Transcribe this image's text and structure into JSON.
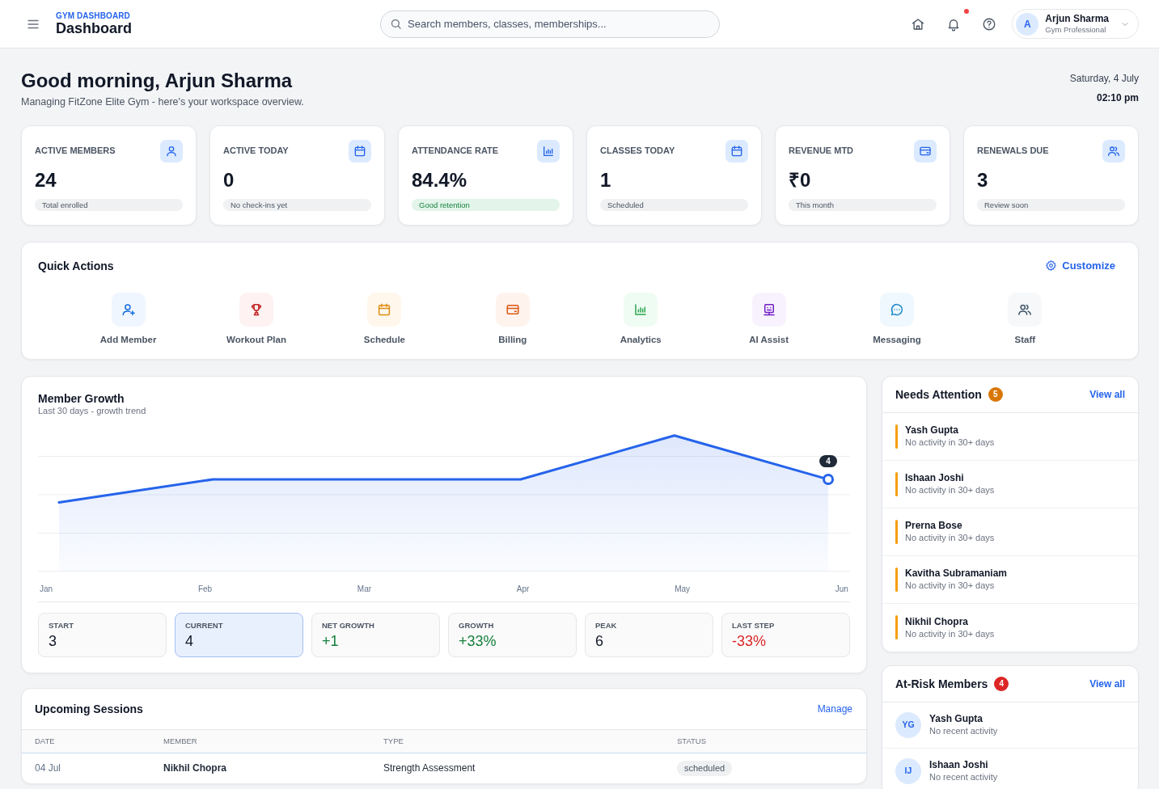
{
  "header": {
    "eyebrow": "GYM DASHBOARD",
    "title": "Dashboard",
    "search": {
      "placeholder": "Search members, classes, memberships..."
    },
    "unread_notifications": true,
    "user": {
      "initial": "A",
      "name": "Arjun Sharma",
      "role": "Gym Professional"
    }
  },
  "greeting": {
    "title": "Good morning, Arjun Sharma",
    "subtitle": "Managing FitZone Elite Gym - here's your workspace overview.",
    "date": "Saturday, 4 July",
    "time": "02:10 pm"
  },
  "stats": [
    {
      "label": "ACTIVE MEMBERS",
      "value": "24",
      "note": "Total enrolled",
      "kind": "neutral"
    },
    {
      "label": "ACTIVE TODAY",
      "value": "0",
      "note": "No check-ins yet",
      "kind": "neutral"
    },
    {
      "label": "ATTENDANCE RATE",
      "value": "84.4%",
      "note": "Good retention",
      "kind": "positive"
    },
    {
      "label": "CLASSES TODAY",
      "value": "1",
      "note": "Scheduled",
      "kind": "neutral"
    },
    {
      "label": "REVENUE MTD",
      "value": "₹0",
      "note": "This month",
      "kind": "neutral"
    },
    {
      "label": "RENEWALS DUE",
      "value": "3",
      "note": "Review soon",
      "kind": "neutral"
    }
  ],
  "quick_actions": {
    "title": "Quick Actions",
    "customize": "Customize",
    "items": [
      {
        "label": "Add Member",
        "color": "#eff6ff"
      },
      {
        "label": "Workout Plan",
        "color": "#fef2f2"
      },
      {
        "label": "Schedule",
        "color": "#fff7eb"
      },
      {
        "label": "Billing",
        "color": "#fff3ed"
      },
      {
        "label": "Analytics",
        "color": "#effcf3"
      },
      {
        "label": "AI Assist",
        "color": "#f8f2fe"
      },
      {
        "label": "Messaging",
        "color": "#eef8fe"
      },
      {
        "label": "Staff",
        "color": "#f6f8fa"
      }
    ]
  },
  "member_growth": {
    "title": "Member Growth",
    "subtitle": "Last 30 days - growth trend",
    "trend": {
      "x_labels": [
        "Jan",
        "Feb",
        "Mar",
        "Apr",
        "May",
        "Jun"
      ],
      "point_label": "4"
    },
    "stats": [
      {
        "label": "START",
        "value": "3",
        "kind": "neutral",
        "highlighted": false
      },
      {
        "label": "CURRENT",
        "value": "4",
        "kind": "neutral",
        "highlighted": true
      },
      {
        "label": "NET GROWTH",
        "value": "+1",
        "kind": "positive",
        "highlighted": false
      },
      {
        "label": "GROWTH",
        "value": "+33%",
        "kind": "positive",
        "highlighted": false
      },
      {
        "label": "PEAK",
        "value": "6",
        "kind": "neutral",
        "highlighted": false
      },
      {
        "label": "LAST STEP",
        "value": "-33%",
        "kind": "negative",
        "highlighted": false
      }
    ]
  },
  "upcoming_sessions": {
    "title": "Upcoming Sessions",
    "action": "Manage",
    "columns": [
      "DATE",
      "MEMBER",
      "TYPE",
      "STATUS"
    ],
    "rows": [
      {
        "date": "04 Jul",
        "member": "Nikhil Chopra",
        "type": "Strength Assessment",
        "status": "scheduled"
      }
    ]
  },
  "needs_attention": {
    "title": "Needs Attention",
    "count": {
      "text": "5",
      "color": "#d97706"
    },
    "action": "View all",
    "items": [
      {
        "name": "Yash Gupta",
        "detail": "No activity in 30+ days"
      },
      {
        "name": "Ishaan Joshi",
        "detail": "No activity in 30+ days"
      },
      {
        "name": "Prerna Bose",
        "detail": "No activity in 30+ days"
      },
      {
        "name": "Kavitha Subramaniam",
        "detail": "No activity in 30+ days"
      },
      {
        "name": "Nikhil Chopra",
        "detail": "No activity in 30+ days"
      }
    ]
  },
  "at_risk": {
    "title": "At-Risk Members",
    "count": {
      "text": "4",
      "color": "#dc2626"
    },
    "action": "View all",
    "items": [
      {
        "initials": "YG",
        "name": "Yash Gupta",
        "detail": "No recent activity"
      },
      {
        "initials": "IJ",
        "name": "Ishaan Joshi",
        "detail": "No recent activity"
      }
    ]
  }
}
